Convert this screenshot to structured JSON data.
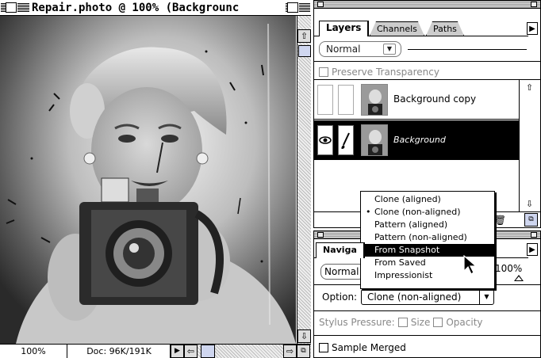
{
  "document_window": {
    "title": "Repair.photo @ 100% (Backgrounc",
    "zoom": "100%",
    "doc_size": "Doc: 96K/191K"
  },
  "layers_palette": {
    "tabs": [
      "Layers",
      "Channels",
      "Paths"
    ],
    "active_tab": "Layers",
    "blend_mode": "Normal",
    "preserve_transparency_label": "Preserve Transparency",
    "layers": [
      {
        "name": "Background copy",
        "visible": false,
        "selected": false
      },
      {
        "name": "Background",
        "visible": true,
        "selected": true
      }
    ]
  },
  "options_palette": {
    "tab_label": "Naviga",
    "mode": "Normal",
    "opacity": "100%",
    "option_label": "Option:",
    "option_value": "Clone (non-aligned)",
    "stylus_pressure_label": "Stylus Pressure:",
    "stylus_size_label": "Size",
    "stylus_opacity_label": "Opacity",
    "sample_merged_label": "Sample Merged"
  },
  "option_menu": {
    "items": [
      "Clone (aligned)",
      "Clone (non-aligned)",
      "Pattern (aligned)",
      "Pattern (non-aligned)",
      "From Snapshot",
      "From Saved",
      "Impressionist"
    ],
    "checked_item": "Clone (non-aligned)",
    "highlighted_item": "From Snapshot"
  }
}
